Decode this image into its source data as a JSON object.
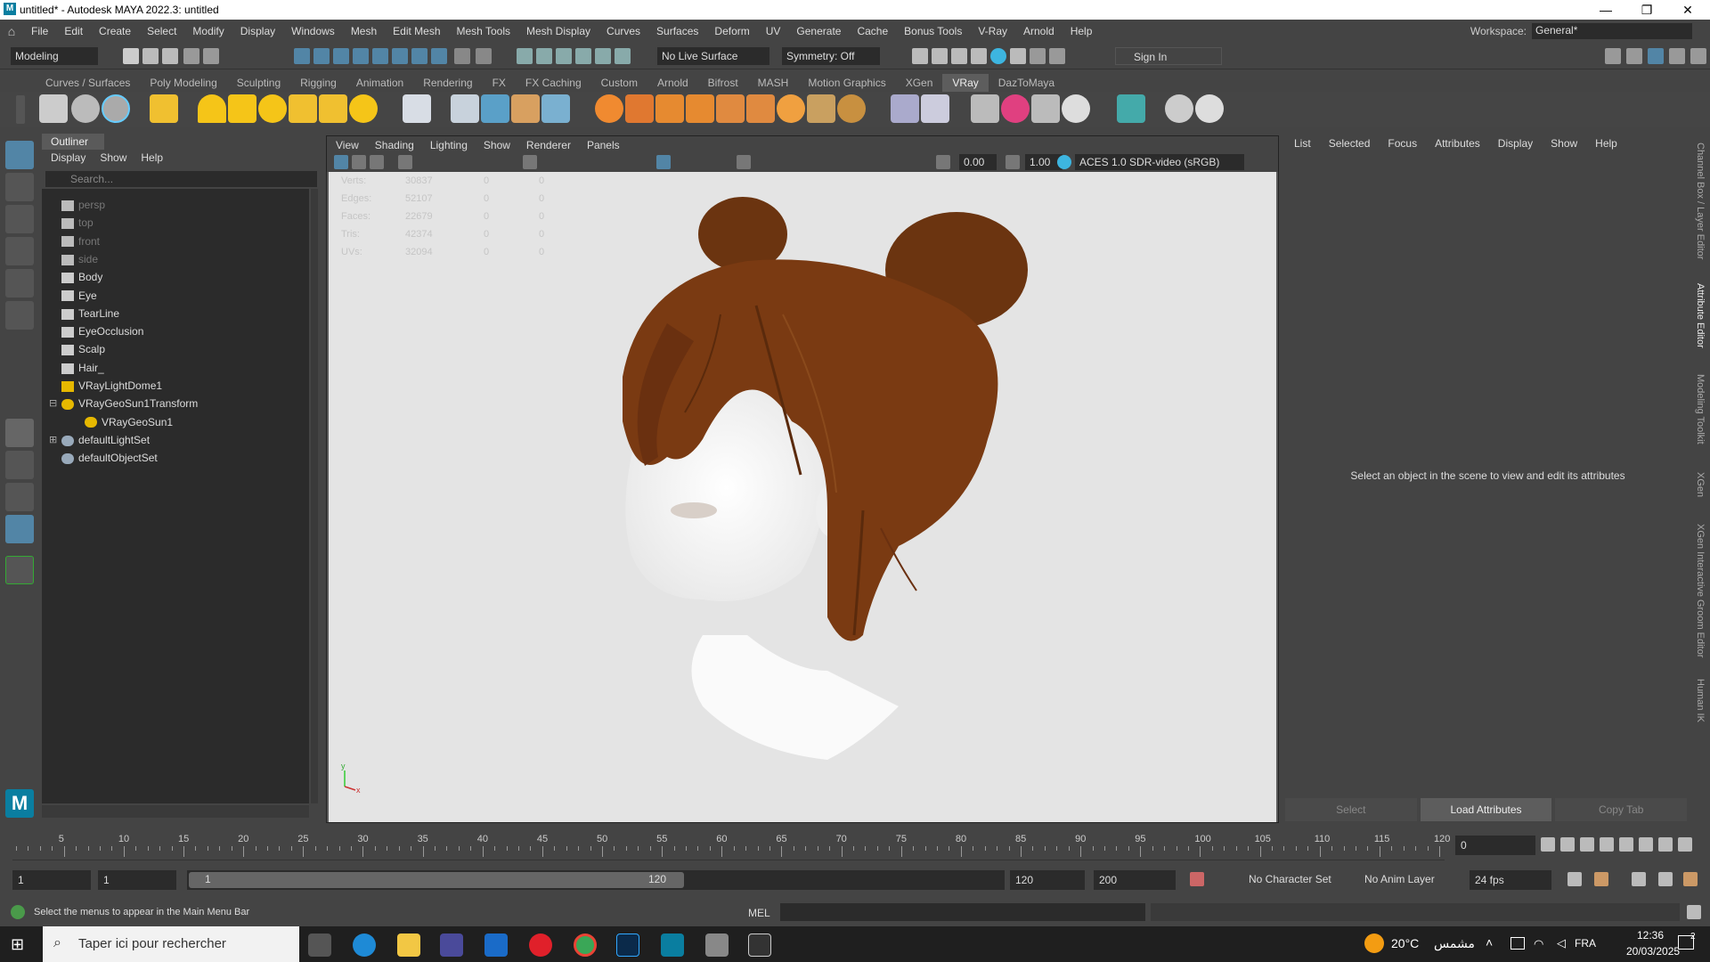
{
  "title": "untitled* - Autodesk MAYA 2022.3: untitled",
  "window_controls": {
    "minimize": "—",
    "restore": "❐",
    "close": "✕"
  },
  "menubar": [
    "File",
    "Edit",
    "Create",
    "Select",
    "Modify",
    "Display",
    "Windows",
    "Mesh",
    "Edit Mesh",
    "Mesh Tools",
    "Mesh Display",
    "Curves",
    "Surfaces",
    "Deform",
    "UV",
    "Generate",
    "Cache",
    "Bonus Tools",
    "V-Ray",
    "Arnold",
    "Help"
  ],
  "workspace": {
    "label": "Workspace:",
    "value": "General*"
  },
  "statusline": {
    "mode": "Modeling",
    "live_surface": "No Live Surface",
    "symmetry": "Symmetry: Off",
    "sign_in": "Sign In"
  },
  "shelf_tabs": [
    "Curves / Surfaces",
    "Poly Modeling",
    "Sculpting",
    "Rigging",
    "Animation",
    "Rendering",
    "FX",
    "FX Caching",
    "Custom",
    "Arnold",
    "Bifrost",
    "MASH",
    "Motion Graphics",
    "XGen",
    "VRay",
    "DazToMaya"
  ],
  "shelf_active": "VRay",
  "outliner": {
    "title": "Outliner",
    "menus": [
      "Display",
      "Show",
      "Help"
    ],
    "search_placeholder": "Search...",
    "items": [
      {
        "label": "persp",
        "icon": "camera-icon",
        "dim": true
      },
      {
        "label": "top",
        "icon": "camera-icon",
        "dim": true
      },
      {
        "label": "front",
        "icon": "camera-icon",
        "dim": true
      },
      {
        "label": "side",
        "icon": "camera-icon",
        "dim": true
      },
      {
        "label": "Body",
        "icon": "mesh-icon",
        "dim": false
      },
      {
        "label": "Eye",
        "icon": "mesh-icon",
        "dim": false
      },
      {
        "label": "TearLine",
        "icon": "mesh-icon",
        "dim": false
      },
      {
        "label": "EyeOcclusion",
        "icon": "mesh-icon",
        "dim": false
      },
      {
        "label": "Scalp",
        "icon": "mesh-icon",
        "dim": false
      },
      {
        "label": "Hair_",
        "icon": "mesh-icon",
        "dim": false
      },
      {
        "label": "VRayLightDome1",
        "icon": "dome-light-icon",
        "dim": false
      },
      {
        "label": "VRayGeoSun1Transform",
        "icon": "sun-icon",
        "dim": false
      },
      {
        "label": "VRayGeoSun1",
        "icon": "sun-icon",
        "dim": false
      },
      {
        "label": "defaultLightSet",
        "icon": "set-icon",
        "dim": false
      },
      {
        "label": "defaultObjectSet",
        "icon": "set-icon",
        "dim": false
      }
    ]
  },
  "viewport": {
    "menus": [
      "View",
      "Shading",
      "Lighting",
      "Show",
      "Renderer",
      "Panels"
    ],
    "exposure": "0.00",
    "gamma": "1.00",
    "color_space": "ACES 1.0 SDR-video (sRGB)",
    "hud": [
      {
        "label": "Verts:",
        "a": "30837",
        "b": "0",
        "c": "0"
      },
      {
        "label": "Edges:",
        "a": "52107",
        "b": "0",
        "c": "0"
      },
      {
        "label": "Faces:",
        "a": "22679",
        "b": "0",
        "c": "0"
      },
      {
        "label": "Tris:",
        "a": "42374",
        "b": "0",
        "c": "0"
      },
      {
        "label": "UVs:",
        "a": "32094",
        "b": "0",
        "c": "0"
      }
    ],
    "axis": {
      "y": "y",
      "x": "x"
    }
  },
  "attribute_editor": {
    "menus": [
      "List",
      "Selected",
      "Focus",
      "Attributes",
      "Display",
      "Show",
      "Help"
    ],
    "message": "Select an object in the scene to view and edit its attributes",
    "buttons": [
      "Select",
      "Load Attributes",
      "Copy Tab"
    ]
  },
  "side_tabs": [
    "Channel Box / Layer Editor",
    "Attribute Editor",
    "Modeling Toolkit",
    "XGen",
    "XGen Interactive Groom Editor",
    "Human IK"
  ],
  "timeline": {
    "ticks": [
      "5",
      "10",
      "15",
      "20",
      "25",
      "30",
      "35",
      "40",
      "45",
      "50",
      "55",
      "60",
      "65",
      "70",
      "75",
      "80",
      "85",
      "90",
      "95",
      "100",
      "105",
      "110",
      "115",
      "120"
    ],
    "current_frame": "0"
  },
  "range": {
    "start": "1",
    "start2": "1",
    "slider_start": "1",
    "slider_end": "120",
    "end": "120",
    "end2": "200",
    "character_set": "No Character Set",
    "anim_layer": "No Anim Layer",
    "fps": "24 fps"
  },
  "command": {
    "help": "Select the menus to appear in the Main Menu Bar",
    "lang": "MEL"
  },
  "taskbar": {
    "search": "Taper ici pour rechercher",
    "weather": "20°C",
    "weather_city": "مشمس",
    "lang": "FRA",
    "time": "12:36",
    "date": "20/03/2025",
    "notif": "2"
  },
  "colors": {
    "bg": "#444444",
    "panel": "#2b2b2b",
    "accent": "#5285a6",
    "hair": "#7a3a12"
  }
}
